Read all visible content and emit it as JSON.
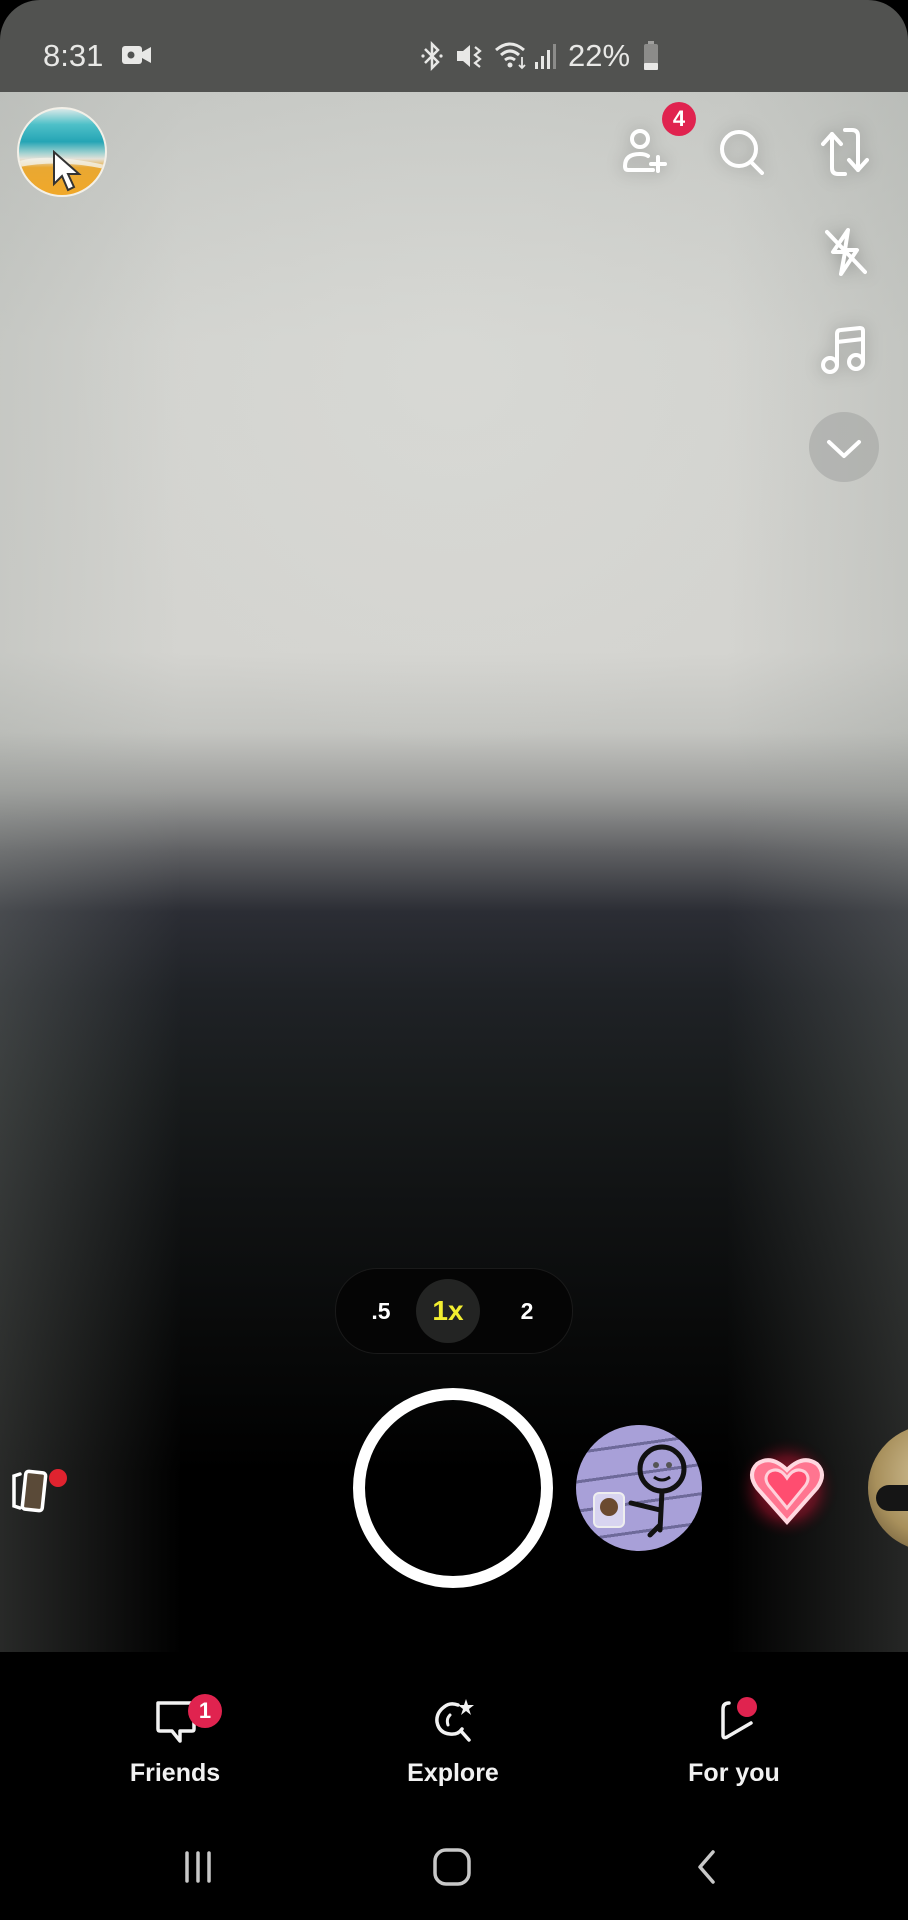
{
  "status_bar": {
    "time": "8:31",
    "battery_percent": "22%",
    "icons": [
      "video-record-icon",
      "bluetooth-icon",
      "vibrate-mute-icon",
      "wifi-icon",
      "signal-icon",
      "battery-icon"
    ]
  },
  "top_bar": {
    "profile_avatar": "profile-avatar",
    "add_friend_badge": "4",
    "icons": [
      "add-friend-icon",
      "search-icon",
      "flip-camera-icon"
    ]
  },
  "side_toolbar": {
    "icons": [
      "flash-off-icon",
      "music-icon",
      "chevron-down-icon"
    ]
  },
  "zoom_selector": {
    "options": [
      ".5",
      "1x",
      "2"
    ],
    "selected": "1x",
    "selected_color": "#f2ee30"
  },
  "capture_row": {
    "memories_icon": "memories-icon",
    "lenses": [
      "stick-figure-lens",
      "neon-heart-lens",
      "face-lens"
    ]
  },
  "bottom_nav": {
    "items": [
      {
        "label": "Friends",
        "icon": "chat-icon",
        "badge": "1"
      },
      {
        "label": "Explore",
        "icon": "explore-icon"
      },
      {
        "label": "For you",
        "icon": "spotlight-icon",
        "dot": true
      }
    ]
  },
  "system_nav": {
    "buttons": [
      "recents-icon",
      "home-icon",
      "back-icon"
    ]
  },
  "colors": {
    "badge": "#e0234f",
    "status_bar_bg": "#515250",
    "zoom_active": "#f2ee30"
  }
}
